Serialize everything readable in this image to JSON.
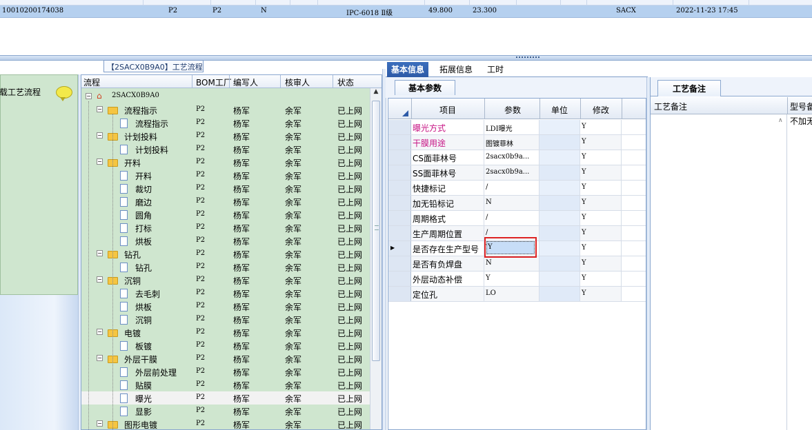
{
  "top_row": {
    "id": "10010200174038",
    "c1": "P2",
    "c2": "P2",
    "c3": "N",
    "model": "IPC-6018 Ⅱ级",
    "v1": "49.800",
    "v2": "23.300",
    "code": "SACX",
    "datetime": "2022-11-23 17:45"
  },
  "left_panel": {
    "label": "载工艺流程"
  },
  "tree": {
    "title": "【2SACX0B9A0】工艺流程",
    "headers": {
      "flow": "流程",
      "factory": "BOM工厂",
      "writer": "编写人",
      "reviewer": "核审人",
      "status": "状态"
    },
    "root": "2SACX0B9A0",
    "rows": [
      {
        "label": "流程指示",
        "kind": "folder",
        "factory": "P2",
        "writer": "杨军",
        "reviewer": "余军",
        "status": "已上网"
      },
      {
        "label": "流程指示",
        "kind": "doc",
        "factory": "P2",
        "writer": "杨军",
        "reviewer": "余军",
        "status": "已上网"
      },
      {
        "label": "计划投料",
        "kind": "folder",
        "factory": "P2",
        "writer": "杨军",
        "reviewer": "余军",
        "status": "已上网"
      },
      {
        "label": "计划投料",
        "kind": "doc",
        "factory": "P2",
        "writer": "杨军",
        "reviewer": "余军",
        "status": "已上网"
      },
      {
        "label": "开料",
        "kind": "folder",
        "factory": "P2",
        "writer": "杨军",
        "reviewer": "余军",
        "status": "已上网"
      },
      {
        "label": "开料",
        "kind": "doc",
        "factory": "P2",
        "writer": "杨军",
        "reviewer": "余军",
        "status": "已上网"
      },
      {
        "label": "裁切",
        "kind": "doc",
        "factory": "P2",
        "writer": "杨军",
        "reviewer": "余军",
        "status": "已上网"
      },
      {
        "label": "磨边",
        "kind": "doc",
        "factory": "P2",
        "writer": "杨军",
        "reviewer": "余军",
        "status": "已上网"
      },
      {
        "label": "圆角",
        "kind": "doc",
        "factory": "P2",
        "writer": "杨军",
        "reviewer": "余军",
        "status": "已上网"
      },
      {
        "label": "打标",
        "kind": "doc",
        "factory": "P2",
        "writer": "杨军",
        "reviewer": "余军",
        "status": "已上网"
      },
      {
        "label": "烘板",
        "kind": "doc",
        "factory": "P2",
        "writer": "杨军",
        "reviewer": "余军",
        "status": "已上网"
      },
      {
        "label": "钻孔",
        "kind": "folder",
        "factory": "P2",
        "writer": "杨军",
        "reviewer": "余军",
        "status": "已上网"
      },
      {
        "label": "钻孔",
        "kind": "doc",
        "factory": "P2",
        "writer": "杨军",
        "reviewer": "余军",
        "status": "已上网"
      },
      {
        "label": "沉铜",
        "kind": "folder",
        "factory": "P2",
        "writer": "杨军",
        "reviewer": "余军",
        "status": "已上网"
      },
      {
        "label": "去毛刺",
        "kind": "doc",
        "factory": "P2",
        "writer": "杨军",
        "reviewer": "余军",
        "status": "已上网"
      },
      {
        "label": "烘板",
        "kind": "doc",
        "factory": "P2",
        "writer": "杨军",
        "reviewer": "余军",
        "status": "已上网"
      },
      {
        "label": "沉铜",
        "kind": "doc",
        "factory": "P2",
        "writer": "杨军",
        "reviewer": "余军",
        "status": "已上网"
      },
      {
        "label": "电镀",
        "kind": "folder",
        "factory": "P2",
        "writer": "杨军",
        "reviewer": "余军",
        "status": "已上网"
      },
      {
        "label": "板镀",
        "kind": "doc",
        "factory": "P2",
        "writer": "杨军",
        "reviewer": "余军",
        "status": "已上网"
      },
      {
        "label": "外层干膜",
        "kind": "folder",
        "factory": "P2",
        "writer": "杨军",
        "reviewer": "余军",
        "status": "已上网"
      },
      {
        "label": "外层前处理",
        "kind": "doc",
        "factory": "P2",
        "writer": "杨军",
        "reviewer": "余军",
        "status": "已上网"
      },
      {
        "label": "贴膜",
        "kind": "doc",
        "factory": "P2",
        "writer": "杨军",
        "reviewer": "余军",
        "status": "已上网"
      },
      {
        "label": "曝光",
        "kind": "doc",
        "factory": "P2",
        "writer": "杨军",
        "reviewer": "余军",
        "status": "已上网",
        "selected": true
      },
      {
        "label": "显影",
        "kind": "doc",
        "factory": "P2",
        "writer": "杨军",
        "reviewer": "余军",
        "status": "已上网"
      },
      {
        "label": "图形电镀",
        "kind": "folder",
        "factory": "P2",
        "writer": "杨军",
        "reviewer": "余军",
        "status": "已上网"
      }
    ]
  },
  "tabs": {
    "basic": "基本信息",
    "ext": "拓展信息",
    "hours": "工时"
  },
  "subtab": "基本参数",
  "grid": {
    "headers": {
      "item": "项目",
      "param": "参数",
      "unit": "单位",
      "modify": "修改"
    },
    "rows": [
      {
        "item": "曝光方式",
        "value": "LDI曝光",
        "modify": "Y",
        "pink": true
      },
      {
        "item": "干膜用途",
        "value": "图镀菲林",
        "modify": "Y",
        "pink": true
      },
      {
        "item": "CS面菲林号",
        "value": "2sacx0b9a...",
        "modify": "Y"
      },
      {
        "item": "SS面菲林号",
        "value": "2sacx0b9a...",
        "modify": "Y"
      },
      {
        "item": "快捷标记",
        "value": "/",
        "modify": "Y"
      },
      {
        "item": "加无铅标记",
        "value": "N",
        "modify": "Y"
      },
      {
        "item": "周期格式",
        "value": "/",
        "modify": "Y"
      },
      {
        "item": "生产周期位置",
        "value": "/",
        "modify": "Y"
      },
      {
        "item": "是否存在生产型号",
        "value": "Y",
        "modify": "Y",
        "current": true
      },
      {
        "item": "是否有负焊盘",
        "value": "N",
        "modify": "Y"
      },
      {
        "item": "外层动态补偿",
        "value": "Y",
        "modify": "Y"
      },
      {
        "item": "定位孔",
        "value": "LO",
        "modify": "Y"
      }
    ]
  },
  "notes": {
    "tab": "工艺备注",
    "col1": "工艺备注",
    "col2": "型号备",
    "value": "不加无"
  },
  "colors": {
    "tree_bg": "#cfe6cf",
    "tab_active": "#2d5aa7",
    "highlight_red": "#d22222",
    "pink": "#c71585"
  },
  "icons": {
    "root": "home-icon",
    "folder": "folder-icon",
    "doc": "document-icon",
    "chat": "chat-bubble-icon",
    "row_pointer": "row-pointer-icon"
  }
}
